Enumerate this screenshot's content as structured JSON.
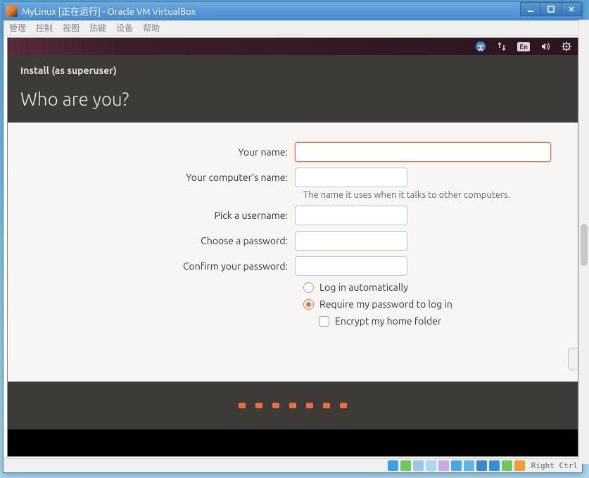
{
  "window": {
    "title": "MyLinux [正在运行] - Oracle VM VirtualBox"
  },
  "menu": {
    "manage": "管理",
    "control": "控制",
    "view": "视图",
    "hotkeys": "热键",
    "device": "设备",
    "help": "帮助"
  },
  "ubuntu_panel": {
    "lang_badge": "En"
  },
  "installer": {
    "subtitle": "Install (as superuser)",
    "heading": "Who are you?"
  },
  "form": {
    "your_name_label": "Your name:",
    "your_name_value": "",
    "computer_label": "Your computer's name:",
    "computer_value": "",
    "computer_hint": "The name it uses when it talks to other computers.",
    "username_label": "Pick a username:",
    "username_value": "",
    "password_label": "Choose a password:",
    "password_value": "",
    "confirm_label": "Confirm your password:",
    "confirm_value": ""
  },
  "options": {
    "auto_login": "Log in automatically",
    "require_password": "Require my password to log in",
    "encrypt_home": "Encrypt my home folder"
  },
  "vbox_status": {
    "host_key": "Right Ctrl"
  }
}
